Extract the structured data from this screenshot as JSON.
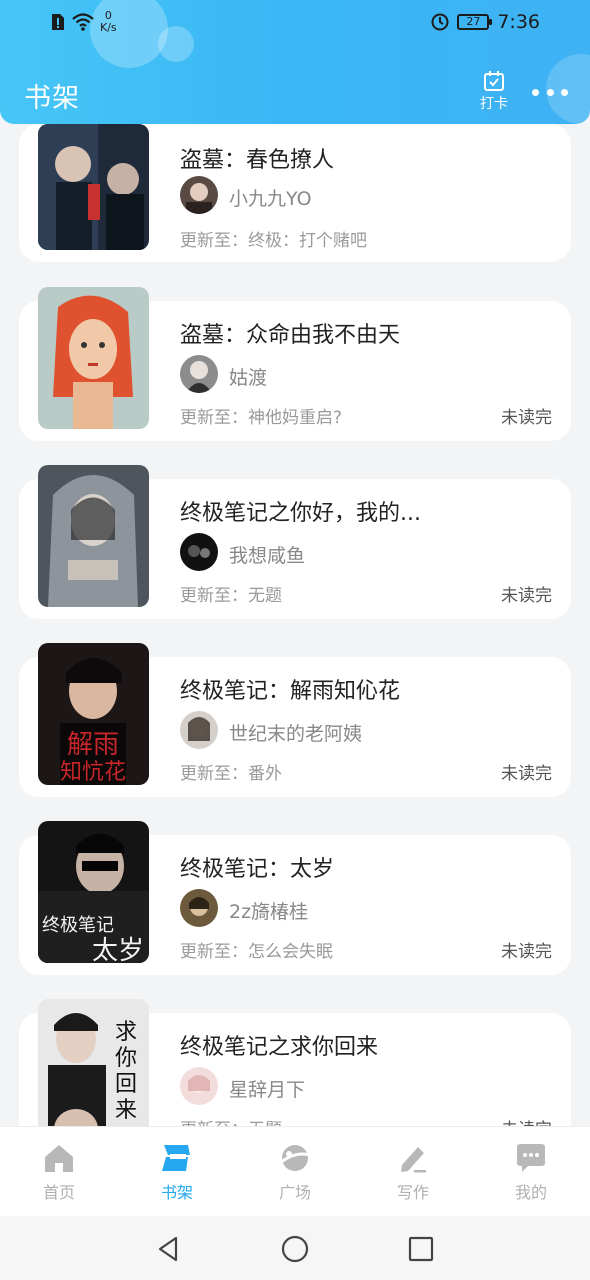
{
  "status_bar": {
    "net_speed_value": "0",
    "net_speed_unit": "K/s",
    "battery": "27",
    "time": "7:36"
  },
  "header": {
    "title": "书架",
    "checkin_label": "打卡"
  },
  "books": [
    {
      "title": "盗墓：春色撩人",
      "author": "小九九YO",
      "update": "更新至：终极：打个赌吧",
      "status": ""
    },
    {
      "title": "盗墓：众命由我不由天",
      "author": "姑渡",
      "update": "更新至：神他妈重启?",
      "status": "未读完"
    },
    {
      "title": "终极笔记之你好，我的...",
      "author": "我想咸鱼",
      "update": "更新至：无题",
      "status": "未读完"
    },
    {
      "title": "终极笔记：解雨知伈花",
      "author": "世纪末的老阿姨",
      "update": "更新至：番外",
      "status": "未读完"
    },
    {
      "title": "终极笔记：太岁",
      "author": "2z旖椿桂",
      "update": "更新至：怎么会失眠",
      "status": "未读完"
    },
    {
      "title": "终极笔记之求你回来",
      "author": "星辞月下",
      "update": "更新至：无题",
      "status": "未读完"
    }
  ],
  "tabs": [
    {
      "label": "首页",
      "icon": "home-icon"
    },
    {
      "label": "书架",
      "icon": "bookshelf-icon"
    },
    {
      "label": "广场",
      "icon": "planet-icon"
    },
    {
      "label": "写作",
      "icon": "pen-icon"
    },
    {
      "label": "我的",
      "icon": "chat-bubble-icon"
    }
  ],
  "colors": {
    "header_gradient_start": "#46c6f7",
    "header_gradient_end": "#3fb2f4",
    "active_tab": "#26a8f0",
    "inactive_tab": "#b0b0b0"
  }
}
